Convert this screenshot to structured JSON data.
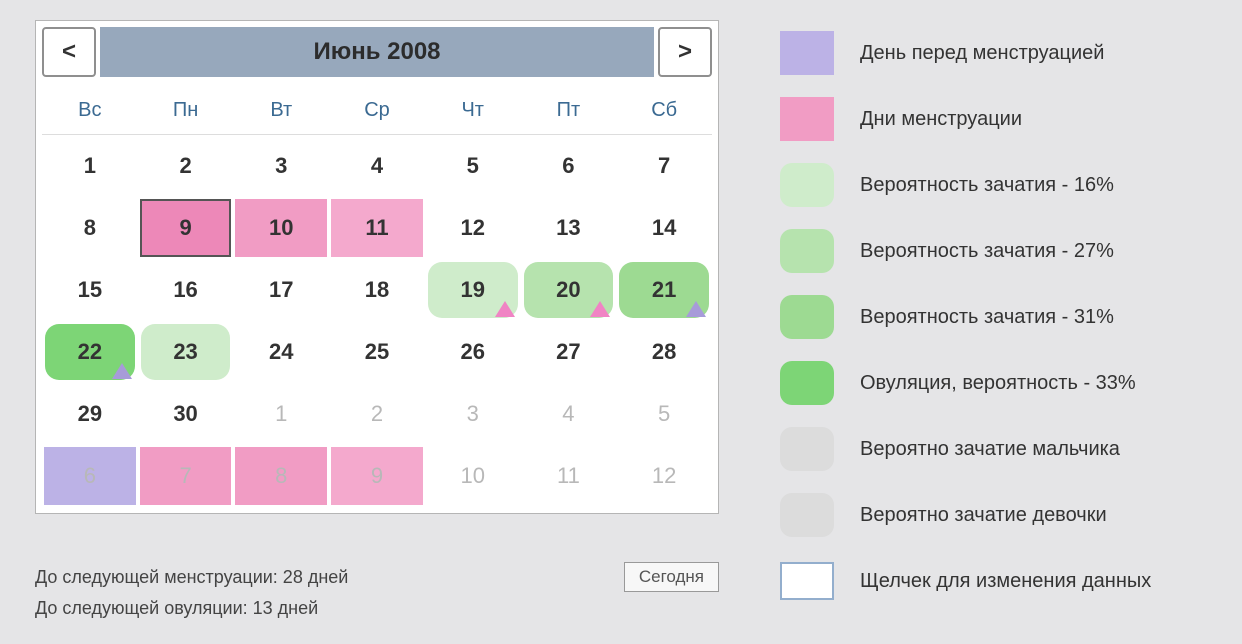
{
  "header": {
    "month_title": "Июнь 2008",
    "prev": "<",
    "next": ">"
  },
  "weekdays": [
    "Вс",
    "Пн",
    "Вт",
    "Ср",
    "Чт",
    "Пт",
    "Сб"
  ],
  "rows": [
    [
      {
        "n": "1"
      },
      {
        "n": "2"
      },
      {
        "n": "3"
      },
      {
        "n": "4"
      },
      {
        "n": "5"
      },
      {
        "n": "6"
      },
      {
        "n": "7"
      }
    ],
    [
      {
        "n": "8"
      },
      {
        "n": "9",
        "cls": "mens-dark",
        "shape": "square"
      },
      {
        "n": "10",
        "cls": "mens",
        "shape": "square"
      },
      {
        "n": "11",
        "cls": "mens-mid",
        "shape": "square"
      },
      {
        "n": "12"
      },
      {
        "n": "13"
      },
      {
        "n": "14"
      }
    ],
    [
      {
        "n": "15"
      },
      {
        "n": "16"
      },
      {
        "n": "17"
      },
      {
        "n": "18"
      },
      {
        "n": "19",
        "cls": "p16",
        "tri": "pink"
      },
      {
        "n": "20",
        "cls": "p27",
        "tri": "pink"
      },
      {
        "n": "21",
        "cls": "p31",
        "tri": "purple"
      }
    ],
    [
      {
        "n": "22",
        "cls": "ovul",
        "tri": "purple"
      },
      {
        "n": "23",
        "cls": "p16"
      },
      {
        "n": "24"
      },
      {
        "n": "25"
      },
      {
        "n": "26"
      },
      {
        "n": "27"
      },
      {
        "n": "28"
      }
    ],
    [
      {
        "n": "29"
      },
      {
        "n": "30"
      },
      {
        "n": "1",
        "other": true
      },
      {
        "n": "2",
        "other": true
      },
      {
        "n": "3",
        "other": true
      },
      {
        "n": "4",
        "other": true
      },
      {
        "n": "5",
        "other": true
      }
    ],
    [
      {
        "n": "6",
        "other": true,
        "cls": "premens",
        "shape": "square"
      },
      {
        "n": "7",
        "other": true,
        "cls": "mens",
        "shape": "square"
      },
      {
        "n": "8",
        "other": true,
        "cls": "mens",
        "shape": "square"
      },
      {
        "n": "9",
        "other": true,
        "cls": "mens-mid",
        "shape": "square"
      },
      {
        "n": "10",
        "other": true
      },
      {
        "n": "11",
        "other": true
      },
      {
        "n": "12",
        "other": true
      }
    ]
  ],
  "footer": {
    "line1": "До следующей менструации: 28 дней",
    "line2": "До следующей овуляции: 13 дней",
    "today": "Сегодня"
  },
  "legend": [
    {
      "cls": "premens",
      "shape": "square",
      "text": "День перед менструацией"
    },
    {
      "cls": "mens",
      "shape": "square",
      "text": "Дни менструации"
    },
    {
      "cls": "p16",
      "text": "Вероятность зачатия - 16%"
    },
    {
      "cls": "p27",
      "text": "Вероятность зачатия - 27%"
    },
    {
      "cls": "p31",
      "text": "Вероятность зачатия - 31%"
    },
    {
      "cls": "ovul",
      "text": "Овуляция, вероятность - 33%"
    },
    {
      "cls": "gray",
      "tri": "purple",
      "text": "Вероятно зачатие мальчика"
    },
    {
      "cls": "gray",
      "tri": "pink",
      "text": "Вероятно зачатие девочки"
    },
    {
      "outline": true,
      "text": "Щелчек для изменения данных"
    }
  ]
}
